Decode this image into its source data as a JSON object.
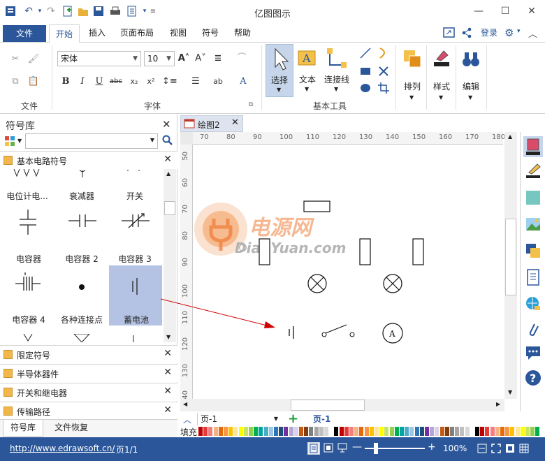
{
  "app": {
    "title": "亿图图示"
  },
  "menu": {
    "file": "文件",
    "tabs": [
      "开始",
      "插入",
      "页面布局",
      "视图",
      "符号",
      "帮助"
    ],
    "login": "登录"
  },
  "ribbon": {
    "font_name": "宋体",
    "font_size": "10",
    "groups": {
      "file": "文件",
      "font": "字体",
      "basic_tools": "基本工具"
    },
    "tools": {
      "select": "选择",
      "text": "文本",
      "connector": "连接线"
    },
    "arrange": "排列",
    "style": "样式",
    "edit": "编辑"
  },
  "library": {
    "title": "符号库",
    "search_placeholder": "",
    "open_category": "基本电路符号",
    "symbols_row0": [
      "电位计电...",
      "衰减器",
      "开关"
    ],
    "symbols_row1": [
      "电容器",
      "电容器 2",
      "电容器 3"
    ],
    "symbols_row2": [
      "电容器 4",
      "各种连接点",
      "蓄电池"
    ],
    "categories": [
      "限定符号",
      "半导体器件",
      "开关和继电器",
      "传输路径"
    ],
    "bottom_tabs": [
      "符号库",
      "文件恢复"
    ]
  },
  "document": {
    "tab_name": "绘图2",
    "hruler": [
      "70",
      "80",
      "90",
      "100",
      "110",
      "120",
      "130",
      "140",
      "150",
      "160",
      "170",
      "180"
    ],
    "vruler": [
      "50",
      "60",
      "70",
      "80",
      "90",
      "100",
      "110",
      "120",
      "130",
      "140"
    ],
    "watermark_cn": "电源网",
    "watermark_en": "DianYuan.com",
    "ammeter_label": "A"
  },
  "pages": {
    "page_select": "页-1",
    "active_page": "页-1",
    "fill_label": "填充"
  },
  "status": {
    "url": "http://www.edrawsoft.cn/",
    "page_info": "页1/1",
    "zoom": "100%"
  },
  "colors": {
    "accent": "#2b579a",
    "selection": "#b4c3e3",
    "arrow": "#d00000"
  }
}
